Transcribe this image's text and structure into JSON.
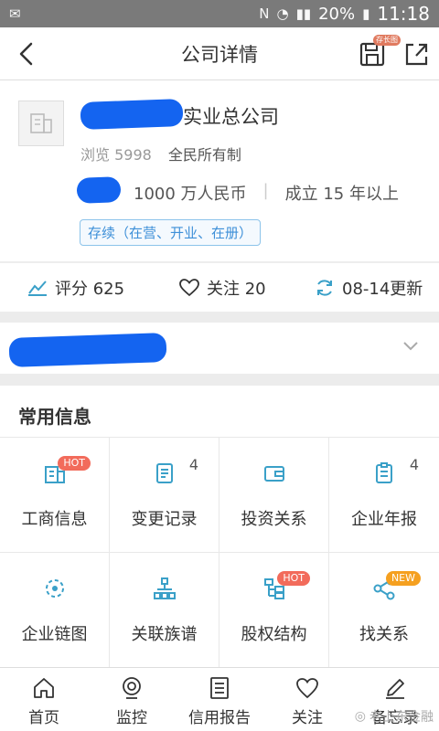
{
  "status_bar": {
    "battery": "20%",
    "time": "11:18"
  },
  "nav": {
    "title": "公司详情",
    "save_tag": "存长图"
  },
  "company": {
    "name_suffix": "实业总公司",
    "views": "浏览 5998",
    "ownership": "全民所有制",
    "capital": "1000 万人民币",
    "founded": "成立 15 年以上",
    "status": "存续（在营、开业、在册）"
  },
  "stats": {
    "score": "评分 625",
    "follow": "关注 20",
    "update": "08-14更新"
  },
  "common_info": {
    "title": "常用信息",
    "items": [
      {
        "label": "工商信息",
        "badge": "HOT",
        "icon": "business-info-icon"
      },
      {
        "label": "变更记录",
        "count": "4",
        "icon": "change-record-icon"
      },
      {
        "label": "投资关系",
        "icon": "investment-icon"
      },
      {
        "label": "企业年报",
        "count": "4",
        "icon": "annual-report-icon"
      },
      {
        "label": "企业链图",
        "icon": "chain-graph-icon"
      },
      {
        "label": "关联族谱",
        "icon": "family-tree-icon"
      },
      {
        "label": "股权结构",
        "badge": "HOT",
        "icon": "equity-structure-icon"
      },
      {
        "label": "找关系",
        "badge": "NEW",
        "icon": "find-relation-icon"
      }
    ]
  },
  "tabbar": {
    "items": [
      {
        "label": "首页",
        "icon": "home-icon"
      },
      {
        "label": "监控",
        "icon": "monitor-icon"
      },
      {
        "label": "信用报告",
        "icon": "report-icon"
      },
      {
        "label": "关注",
        "icon": "heart-icon"
      },
      {
        "label": "备忘录",
        "icon": "pencil-icon"
      }
    ]
  },
  "watermark": "老上东金融",
  "colors": {
    "accent": "#3aa0c8",
    "badge_hot": "#f26b5b",
    "badge_new": "#f5a020",
    "redaction": "#1464f0"
  }
}
